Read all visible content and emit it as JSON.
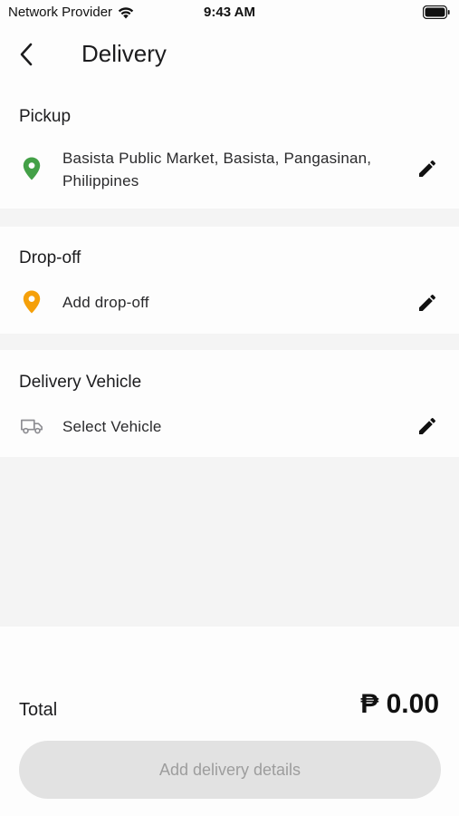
{
  "status_bar": {
    "carrier": "Network Provider",
    "time": "9:43 AM"
  },
  "header": {
    "title": "Delivery"
  },
  "pickup": {
    "title": "Pickup",
    "address": "Basista Public Market, Basista, Pangasinan, Philippines",
    "icon_color": "#43a047"
  },
  "dropoff": {
    "title": "Drop-off",
    "placeholder": "Add drop-off",
    "icon_color": "#f5a00a"
  },
  "vehicle": {
    "title": "Delivery Vehicle",
    "placeholder": "Select Vehicle"
  },
  "footer": {
    "total_label": "Total",
    "total_amount": "₱ 0.00",
    "submit_label": "Add delivery details"
  }
}
